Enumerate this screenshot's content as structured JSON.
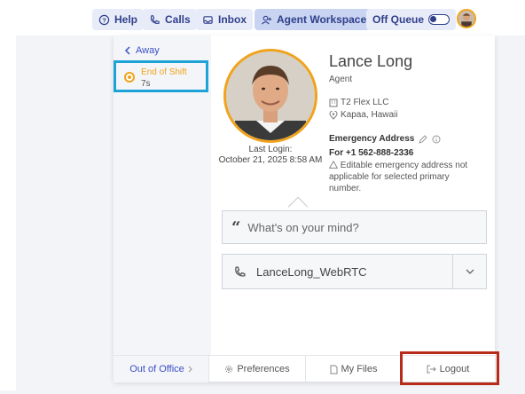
{
  "topnav": {
    "help": "Help",
    "calls": "Calls",
    "inbox": "Inbox",
    "agent_workspace": "Agent Workspace",
    "off_queue": "Off Queue"
  },
  "sidebar": {
    "away_label": "Away",
    "status_name": "End of Shift",
    "status_time": "7s"
  },
  "profile": {
    "name": "Lance Long",
    "role": "Agent",
    "last_login_label": "Last Login:",
    "last_login_value": "October 21, 2025 8:58 AM",
    "company": "T2 Flex LLC",
    "location": "Kapaa, Hawaii",
    "emergency_heading": "Emergency Address",
    "emergency_number": "For +1 562-888-2336",
    "emergency_note": "Editable emergency address not applicable for selected primary number."
  },
  "mind_placeholder": "What's on your mind?",
  "phone_selector": "LanceLong_WebRTC",
  "footer": {
    "out_of_office": "Out of Office",
    "preferences": "Preferences",
    "my_files": "My Files",
    "logout": "Logout"
  },
  "colors": {
    "accent": "#3b4fc4",
    "status": "#f0a31c",
    "highlight_status": "#1ea3d8",
    "highlight_logout": "#b82a1a"
  }
}
